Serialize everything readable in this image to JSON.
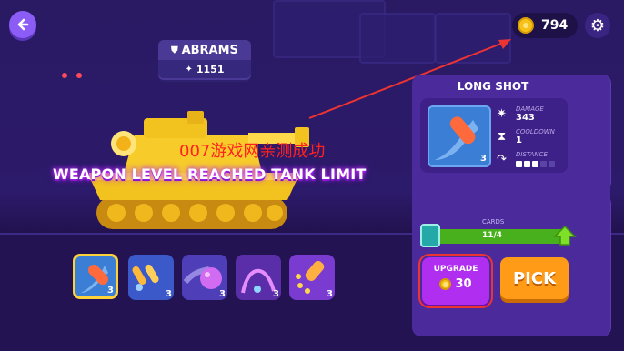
{
  "top_bar": {
    "back_icon": "back-arrow-icon",
    "coins": "794",
    "settings_icon": "gear-icon"
  },
  "tank": {
    "name": "ABRAMS",
    "power": "1151",
    "watermark": "007游戏网亲测成功",
    "limit_message": "WEAPON LEVEL REACHED TANK LIMIT"
  },
  "weapons": [
    {
      "name": "long-shot",
      "level": "3",
      "selected": true
    },
    {
      "name": "missiles",
      "level": "3",
      "selected": false
    },
    {
      "name": "plasma-ball",
      "level": "3",
      "selected": false
    },
    {
      "name": "arc-shot",
      "level": "3",
      "selected": false
    },
    {
      "name": "cluster-bomb",
      "level": "3",
      "selected": false
    }
  ],
  "weapon_panel": {
    "title": "LONG SHOT",
    "image_level": "3",
    "stats": [
      {
        "label": "DAMAGE",
        "value": "343",
        "icon": "damage-icon"
      },
      {
        "label": "COOLDOWN",
        "value": "1",
        "icon": "hourglass-icon"
      },
      {
        "label": "DISTANCE",
        "value": "",
        "icon": "distance-icon",
        "level": 3,
        "max": 5
      }
    ],
    "cards_label": "CARDS",
    "cards_value": "11/4",
    "upgrade_label": "UPGRADE",
    "upgrade_cost": "30",
    "pick_label": "PICK"
  },
  "colors": {
    "accent_purple": "#8b5cf6",
    "pick_orange": "#ff9b16",
    "upgrade_purple": "#b02ef0",
    "progress_green": "#47b01c",
    "annotation_red": "#e33333"
  }
}
